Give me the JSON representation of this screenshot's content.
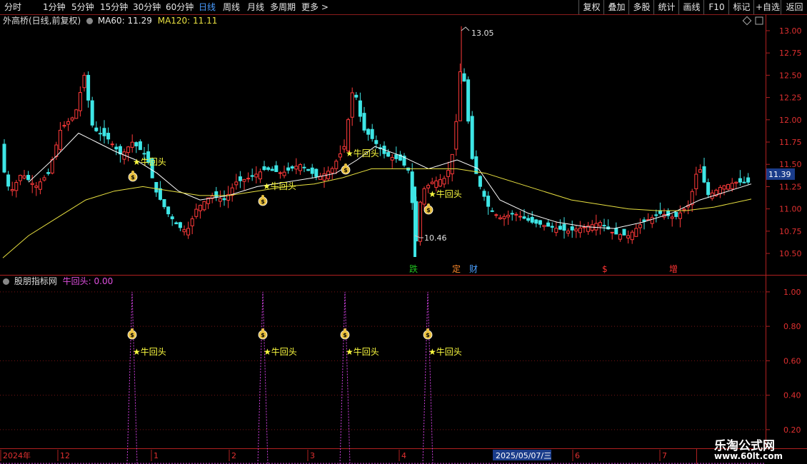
{
  "toolbar": {
    "periods": [
      {
        "label": "分时",
        "active": false
      },
      {
        "label": "1分钟",
        "active": false
      },
      {
        "label": "5分钟",
        "active": false
      },
      {
        "label": "15分钟",
        "active": false
      },
      {
        "label": "30分钟",
        "active": false
      },
      {
        "label": "60分钟",
        "active": false
      },
      {
        "label": "日线",
        "active": true
      },
      {
        "label": "周线",
        "active": false
      },
      {
        "label": "月线",
        "active": false
      },
      {
        "label": "多周期",
        "active": false
      },
      {
        "label": "更多 >",
        "active": false
      }
    ],
    "right_buttons": [
      "复权",
      "叠加",
      "多股",
      "统计",
      "画线",
      "F10",
      "标记",
      "+自选",
      "返回"
    ]
  },
  "main_panel": {
    "stock_label": "外高桥(日线,前复权)",
    "ma60_label": "MA60: 11.29",
    "ma120_label": "MA120: 11.11",
    "current_price": "11.39",
    "high_label": "13.05",
    "low_label": "10.46",
    "signal_text": "★牛回头",
    "event_marks": [
      {
        "text": "跌",
        "color": "#20c020"
      },
      {
        "text": "定",
        "color": "#ff8a2a"
      },
      {
        "text": "财",
        "color": "#4aa0ff"
      },
      {
        "text": "$",
        "color": "#ff3333"
      },
      {
        "text": "增",
        "color": "#ff3333"
      }
    ]
  },
  "indicator_panel": {
    "name": "股朋指标网",
    "value_label": "牛回头: 0.00",
    "signal_text": "★牛回头"
  },
  "time_axis": {
    "labels": [
      "2024年",
      "12",
      "1",
      "2",
      "3",
      "4",
      "2025/05/07/三",
      "6",
      "7"
    ]
  },
  "watermark": {
    "title": "乐淘公式网",
    "url": "www.60lt.com"
  },
  "chart_data": [
    {
      "type": "candlestick",
      "ylim": [
        10.3,
        13.12
      ],
      "y_ticks": [
        10.5,
        10.75,
        11.0,
        11.25,
        11.5,
        11.75,
        12.0,
        12.25,
        12.5,
        12.75,
        13.0
      ],
      "y_tick_labels": [
        "10.50",
        "10.75",
        "11.00",
        "11.25",
        "11.50",
        "11.75",
        "12.00",
        "12.25",
        "12.50",
        "12.75",
        "13.00"
      ],
      "series": [
        {
          "name": "MA60",
          "color": "#ffffff"
        },
        {
          "name": "MA120",
          "color": "#e8e040"
        }
      ],
      "high": 13.05,
      "low": 10.46,
      "current_price": 11.39,
      "signals": [
        "牛回头",
        "牛回头",
        "牛回头",
        "牛回头"
      ]
    },
    {
      "type": "line",
      "ylim": [
        0.1,
        1.07
      ],
      "y_ticks": [
        0.2,
        0.4,
        0.6,
        0.8,
        1.0
      ],
      "y_tick_labels": [
        "0.20",
        "0.40",
        "0.60",
        "0.80",
        "1.00"
      ],
      "series": [
        {
          "name": "牛回头",
          "values_peak": [
            1.0,
            1.0,
            1.0,
            1.0
          ],
          "baseline": 0.0,
          "color": "#d040e0"
        }
      ]
    }
  ]
}
